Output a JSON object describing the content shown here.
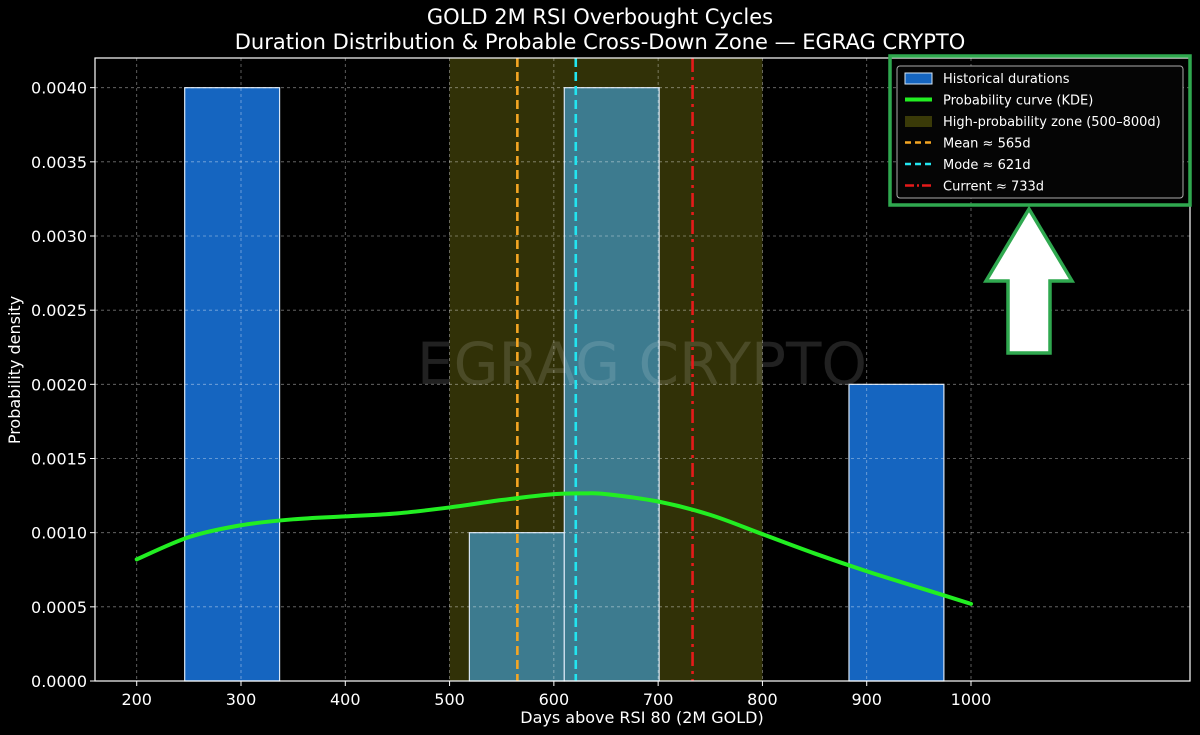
{
  "chart_data": {
    "type": "bar",
    "title": "GOLD 2M RSI Overbought Cycles",
    "subtitle": "Duration Distribution & Probable Cross-Down Zone — EGRAG CRYPTO",
    "xlabel": "Days above RSI 80 (2M GOLD)",
    "ylabel": "Probability density",
    "xlim": [
      160,
      1210
    ],
    "ylim": [
      0,
      0.0042
    ],
    "x_ticks": [
      200,
      300,
      400,
      500,
      600,
      700,
      800,
      900,
      1000
    ],
    "y_ticks": [
      0.0,
      0.0005,
      0.001,
      0.0015,
      0.002,
      0.0025,
      0.003,
      0.0035,
      0.004
    ],
    "y_tick_labels": [
      "0.0000",
      "0.0005",
      "0.0010",
      "0.0015",
      "0.0020",
      "0.0025",
      "0.0030",
      "0.0035",
      "0.0040"
    ],
    "grid": true,
    "watermark": "EGRAG CRYPTO",
    "histogram": {
      "name": "Historical durations",
      "bins": [
        {
          "x0": 246,
          "x1": 337,
          "density": 0.004,
          "zone": false
        },
        {
          "x0": 519,
          "x1": 610,
          "density": 0.001,
          "zone": true
        },
        {
          "x0": 610,
          "x1": 701,
          "density": 0.004,
          "zone": true
        },
        {
          "x0": 883,
          "x1": 974,
          "density": 0.002,
          "zone": false
        }
      ],
      "color": "#1565c0",
      "zone_color": "#3d7b8f"
    },
    "kde": {
      "name": "Probability curve (KDE)",
      "color": "#22ee22",
      "x": [
        200,
        250,
        300,
        350,
        400,
        450,
        500,
        550,
        600,
        630,
        650,
        700,
        750,
        800,
        850,
        900,
        950,
        1000
      ],
      "y": [
        0.00082,
        0.00097,
        0.00105,
        0.00109,
        0.00111,
        0.00113,
        0.00117,
        0.00122,
        0.00126,
        0.001265,
        0.00126,
        0.00121,
        0.00112,
        0.00099,
        0.00086,
        0.00074,
        0.00063,
        0.00052
      ]
    },
    "zone": {
      "name": "High-probability zone (500–800d)",
      "x0": 500,
      "x1": 800,
      "color": "#3a3a08"
    },
    "lines": [
      {
        "name": "Mean ≈ 565d",
        "x": 565,
        "color": "#f5a623",
        "style": "dashed"
      },
      {
        "name": "Mode ≈ 621d",
        "x": 621,
        "color": "#22e5f0",
        "style": "dashed"
      },
      {
        "name": "Current ≈ 733d",
        "x": 733,
        "color": "#e51a1a",
        "style": "dashdot"
      }
    ],
    "legend": {
      "position": "top-right",
      "entries": [
        "Historical durations",
        "Probability curve (KDE)",
        "High-probability zone (500–800d)",
        "Mean ≈ 565d",
        "Mode ≈ 621d",
        "Current ≈ 733d"
      ]
    },
    "annotation": {
      "type": "arrow-up",
      "color": "#2fa84f",
      "target": "legend"
    }
  }
}
